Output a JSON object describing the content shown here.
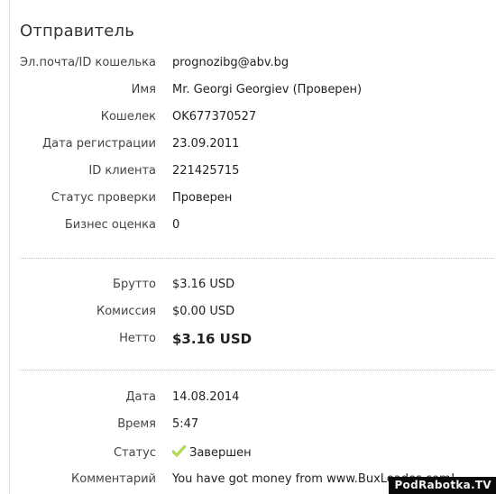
{
  "sender": {
    "title": "Отправитель",
    "rows": [
      {
        "label": "Эл.почта/ID кошелька",
        "value": "prognozibg@abv.bg"
      },
      {
        "label": "Имя",
        "value": "Mr. Georgi Georgiev (Проверен)"
      },
      {
        "label": "Кошелек",
        "value": "OK677370527"
      },
      {
        "label": "Дата регистрации",
        "value": "23.09.2011"
      },
      {
        "label": "ID клиента",
        "value": "221425715"
      },
      {
        "label": "Статус проверки",
        "value": "Проверен"
      },
      {
        "label": "Бизнес оценка",
        "value": "0"
      }
    ]
  },
  "amounts": {
    "gross_label": "Брутто",
    "gross_value": "$3.16 USD",
    "fee_label": "Комиссия",
    "fee_value": "$0.00 USD",
    "net_label": "Нетто",
    "net_value": "$3.16 USD"
  },
  "details": {
    "date_label": "Дата",
    "date_value": "14.08.2014",
    "time_label": "Время",
    "time_value": "5:47",
    "status_label": "Статус",
    "status_value": "Завершен",
    "status_icon": "check-icon",
    "comment_label": "Комментарий",
    "comment_value": "You have got money from www.BuxLeades.com!"
  },
  "watermark": "PodRabotka.TV",
  "colors": {
    "check": "#9acd32",
    "watermark_bg": "#0a0a0a"
  }
}
